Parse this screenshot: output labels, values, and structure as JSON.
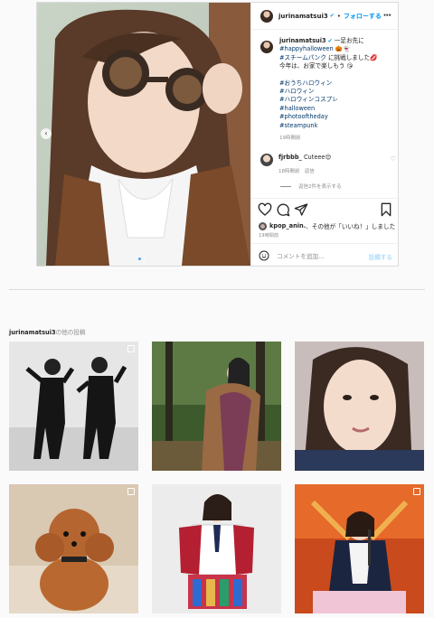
{
  "post": {
    "username": "jurinamatsui3",
    "follow_label": "フォローする",
    "caption_line1": "一足お先に",
    "caption_tag1": "#happyhalloween",
    "caption_line2_tag": "#スチームパンク",
    "caption_line2_rest": "に挑戦しました",
    "caption_line3": "今年は、お家で楽しもう",
    "hashtags": [
      "#おうちハロウィン",
      "#ハロウィン",
      "#ハロウィンコスプレ",
      "#halloween",
      "#photooftheday",
      "#steampunk"
    ],
    "caption_time": "19時間前",
    "comment": {
      "user": "fjrbbb_",
      "text": "Cuteee",
      "time": "18時間前",
      "reply_label": "返信"
    },
    "view_replies": "返信2件を表示する",
    "likes_user": "kpop_anin.",
    "likes_rest": "その他が「いいね！」しました",
    "posted_ago": "19時間前",
    "comment_placeholder": "コメントを追加...",
    "post_button": "投稿する"
  },
  "more_posts": {
    "title_user": "jurinamatsui3",
    "title_suffix": "の他の投稿"
  },
  "thumbnails": [
    {
      "name": "thumb-dancers-bw"
    },
    {
      "name": "thumb-fur-coat-forest"
    },
    {
      "name": "thumb-selfie"
    },
    {
      "name": "thumb-poodle"
    },
    {
      "name": "thumb-idol-uniform"
    },
    {
      "name": "thumb-stage-performance"
    }
  ],
  "colors": {
    "link": "#0095f6",
    "tag": "#00376b",
    "muted": "#8e8e8e",
    "border": "#dbdbdb"
  }
}
